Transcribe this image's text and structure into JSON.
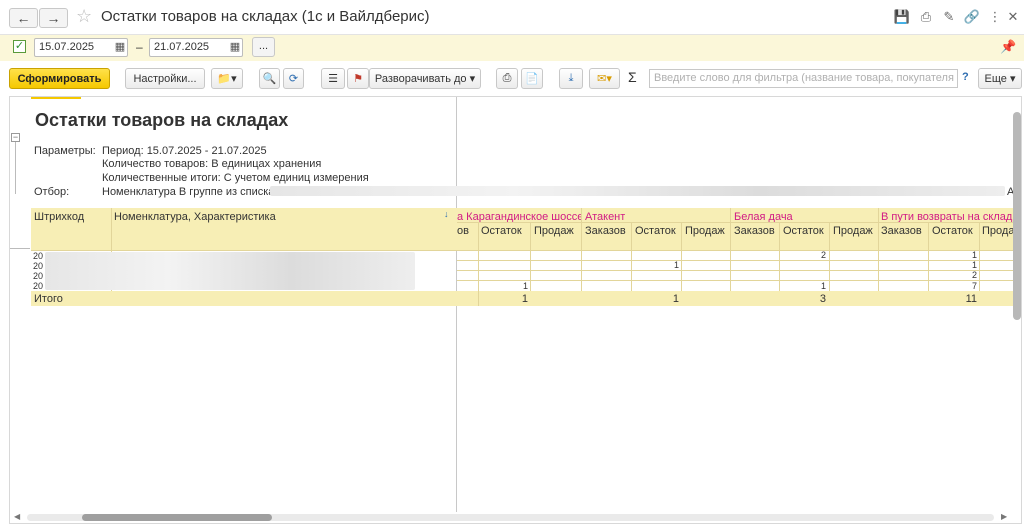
{
  "window": {
    "title": "Остатки товаров на складах (1с и Вайлдберис)"
  },
  "params_bar": {
    "date_from": "15.07.2025",
    "date_to": "21.07.2025",
    "dash": "–",
    "dots": "..."
  },
  "toolbar": {
    "generate_label": "Сформировать",
    "settings_label": "Настройки...",
    "expand_label": "Разворачивать до",
    "sigma": "Σ",
    "filter_placeholder": "Введите слово для фильтра (название товара, покупателя и ...",
    "help": "?",
    "more_label": "Еще"
  },
  "report": {
    "title": "Остатки товаров на складах",
    "params_label": "Параметры:",
    "period": "Период: 15.07.2025 - 21.07.2025",
    "qty": "Количество товаров: В единицах хранения",
    "qty_totals": "Количественные итоги: С учетом единиц измерения",
    "filter_label": "Отбор:",
    "filter_value": "Номенклатура В группе из списка \"",
    "filter_tail": "А",
    "col_barcode": "Штрихкод",
    "col_item": "Номенклатура, Характеристика",
    "sort_icon": "↓",
    "warehouses": [
      "а Карагандинское шоссе",
      "Атакент",
      "Белая дача",
      "В пути возвраты на склад W"
    ],
    "sub_headers": [
      "ов",
      "Остаток",
      "Продаж",
      "Заказов",
      "Остаток",
      "Продаж",
      "Заказов",
      "Остаток",
      "Продаж",
      "Заказов",
      "Остаток",
      "Прода"
    ],
    "rows": [
      {
        "barcode": "20",
        "v": [
          "",
          "",
          "",
          "",
          "",
          "",
          "",
          "2",
          "",
          "",
          "1",
          ""
        ]
      },
      {
        "barcode": "20",
        "v": [
          "",
          "",
          "",
          "",
          "1",
          "",
          "",
          "",
          "",
          "",
          "1",
          ""
        ]
      },
      {
        "barcode": "20",
        "v": [
          "",
          "",
          "",
          "",
          "",
          "",
          "",
          "",
          "",
          "",
          "2",
          ""
        ]
      },
      {
        "barcode": "20",
        "v": [
          "",
          "1",
          "",
          "",
          "",
          "",
          "",
          "1",
          "",
          "",
          "7",
          ""
        ]
      }
    ],
    "total_label": "Итого",
    "totals": [
      "",
      "1",
      "",
      "",
      "1",
      "",
      "",
      "3",
      "",
      "",
      "11",
      ""
    ]
  }
}
